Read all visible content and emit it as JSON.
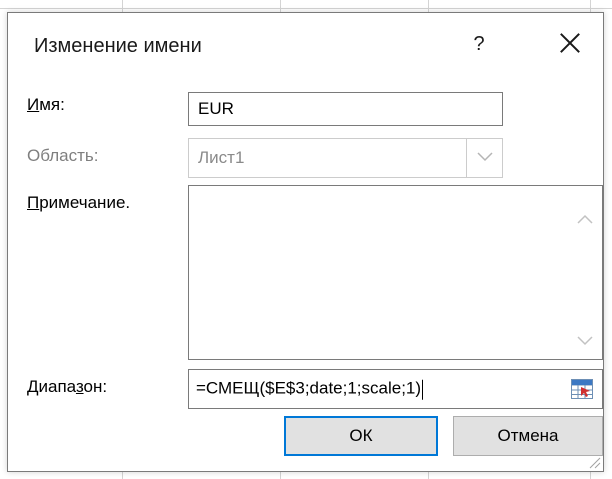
{
  "dialog": {
    "title": "Изменение имени",
    "help_label": "?",
    "close_icon": "close-icon"
  },
  "name_field": {
    "label_pre": "",
    "label_u": "И",
    "label_post": "мя:",
    "value": "EUR"
  },
  "scope_field": {
    "label": "Область:",
    "value": "Лист1",
    "disabled": true
  },
  "comment_field": {
    "label_u": "П",
    "label_post": "римечание.",
    "value": ""
  },
  "range_field": {
    "label_pre": "Диапа",
    "label_u": "з",
    "label_post": "он:",
    "value": "=СМЕЩ($E$3;date;1;scale;1)"
  },
  "buttons": {
    "ok_label": "ОК",
    "cancel_label": "Отмена"
  },
  "colors": {
    "accent": "#0078d7",
    "border": "#7a7a7a",
    "disabled_text": "#7f7f7f"
  }
}
